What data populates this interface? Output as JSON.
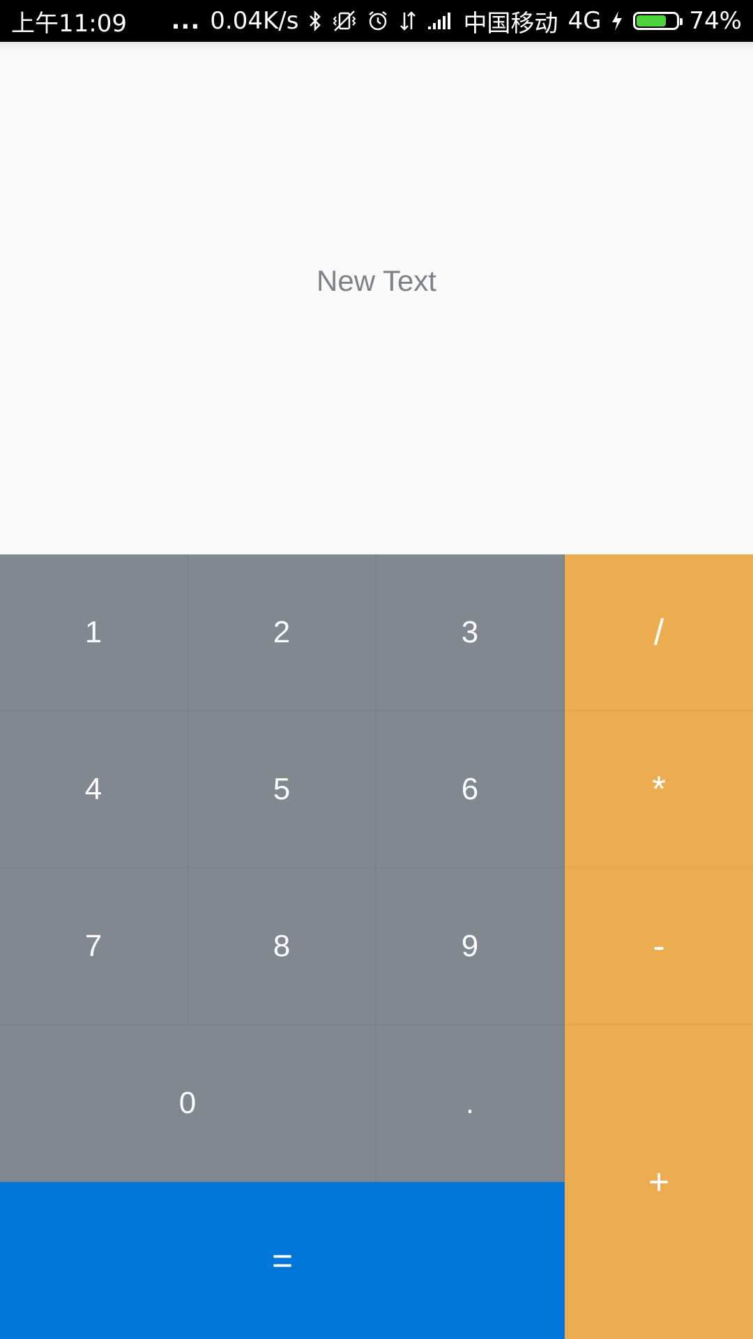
{
  "status_bar": {
    "time": "上午11:09",
    "dots": "...",
    "net_speed": "0.04K/s",
    "carrier": "中国移动",
    "network": "4G",
    "battery_percent": "74%",
    "battery_level": 0.74,
    "battery_color": "#4cd43a",
    "icons": [
      "bluetooth-icon",
      "vibrate-icon",
      "alarm-icon",
      "data-transfer-icon",
      "signal-icon",
      "charging-icon",
      "battery-icon"
    ]
  },
  "display": {
    "text": "New Text"
  },
  "keys": {
    "k1": "1",
    "k2": "2",
    "k3": "3",
    "div": "/",
    "k4": "4",
    "k5": "5",
    "k6": "6",
    "mul": "*",
    "k7": "7",
    "k8": "8",
    "k9": "9",
    "sub": "-",
    "k0": "0",
    "dot": ".",
    "add": "+",
    "eq": "="
  },
  "colors": {
    "number_key": "#818890",
    "operator_key": "#eeac50",
    "equals_key": "#0076da",
    "display_text": "#7d8189"
  }
}
